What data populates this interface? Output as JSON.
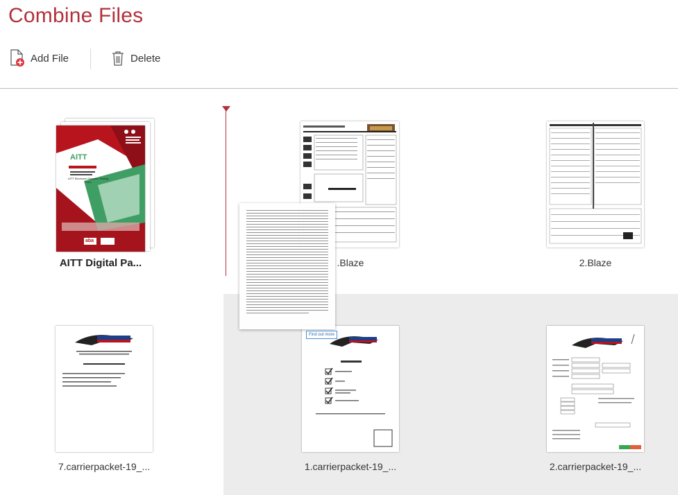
{
  "title": "Combine Files",
  "toolbar": {
    "add_file_label": "Add File",
    "delete_label": "Delete"
  },
  "files": [
    {
      "label": "AITT Digital Pa...",
      "selected": true
    },
    {
      "label": ".Blaze"
    },
    {
      "label": "2.Blaze"
    },
    {
      "label": "7.carrierpacket-19_..."
    },
    {
      "label": "1.carrierpacket-19_..."
    },
    {
      "label": "2.carrierpacket-19_..."
    }
  ],
  "cover": {
    "brand": "AITT",
    "heading": "AITT Electronic Operator Testing Form",
    "footer_logo": "aba"
  },
  "drag_pill_text": "Find out more",
  "colors": {
    "accent": "#b2313b",
    "add_badge": "#d9363e"
  }
}
